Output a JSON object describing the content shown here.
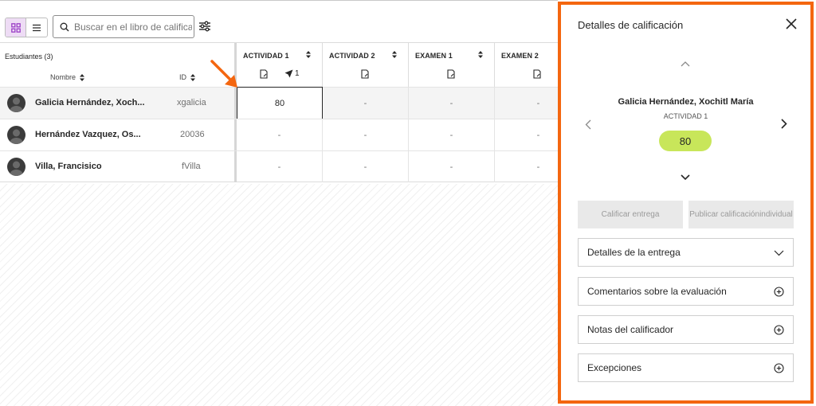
{
  "toolbar": {
    "search_placeholder": "Buscar en el libro de calificaciones"
  },
  "grid": {
    "students_header": "Estudiantes (3)",
    "name_sort_label": "Nombre",
    "id_sort_label": "ID",
    "columns": [
      {
        "title": "ACTIVIDAD 1",
        "sent_count": "1"
      },
      {
        "title": "ACTIVIDAD 2"
      },
      {
        "title": "EXAMEN 1"
      },
      {
        "title": "EXAMEN 2"
      }
    ],
    "rows": [
      {
        "name": "Galicia Hernández, Xoch...",
        "id": "xgalicia",
        "grades": [
          "80",
          "-",
          "-",
          "-"
        ]
      },
      {
        "name": "Hernández Vazquez, Os...",
        "id": "20036",
        "grades": [
          "-",
          "-",
          "-",
          "-"
        ]
      },
      {
        "name": "Villa, Francisico",
        "id": "fVilla",
        "grades": [
          "-",
          "-",
          "-",
          "-"
        ]
      }
    ]
  },
  "panel": {
    "title": "Detalles de calificación",
    "student_name": "Galicia Hernández, Xochitl María",
    "activity": "ACTIVIDAD 1",
    "grade": "80",
    "grade_button": "Calificar entrega",
    "publish_button_line1": "Publicar calificación",
    "publish_button_line2": "individual",
    "sections": [
      "Detalles de la entrega",
      "Comentarios sobre la evaluación",
      "Notas del calificador",
      "Excepciones"
    ]
  },
  "colors": {
    "accent_orange": "#f4660f",
    "grade_pill": "#c8e65a",
    "toggle_active": "#eedcf5",
    "grid_icon": "#9b3fc6"
  }
}
